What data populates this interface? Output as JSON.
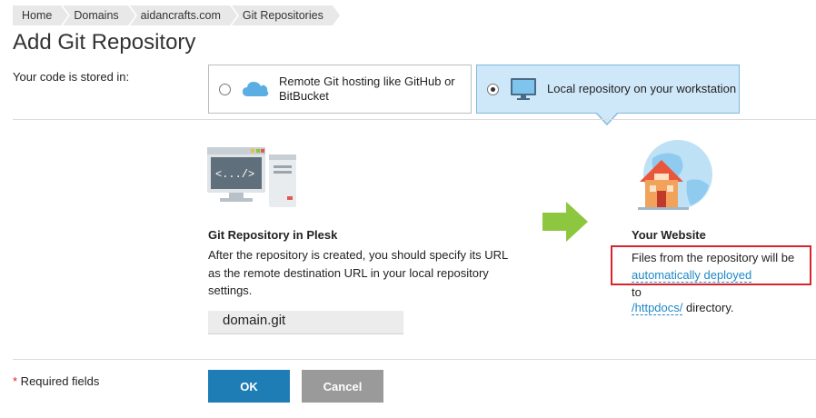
{
  "breadcrumb": [
    "Home",
    "Domains",
    "aidancrafts.com",
    "Git Repositories"
  ],
  "page_title": "Add Git Repository",
  "stored_label": "Your code is stored in:",
  "options": {
    "remote": {
      "label": "Remote Git hosting like GitHub or BitBucket",
      "selected": false,
      "icon": "cloud-icon"
    },
    "local": {
      "label": "Local repository on your workstation",
      "selected": true,
      "icon": "monitor-icon"
    }
  },
  "plesk": {
    "icon_text": "<.../>",
    "title": "Git Repository in Plesk",
    "description": "After the repository is created, you should specify its URL as the remote destination URL in your local repository settings.",
    "repo_name": "domain.git"
  },
  "website": {
    "title": "Your Website",
    "desc_prefix": "Files from the repository will be",
    "deploy_link": "automatically deployed",
    "to_text": "to",
    "dir_link": "/httpdocs/",
    "dir_suffix": " directory."
  },
  "footer": {
    "required_star": "*",
    "required_text": " Required fields",
    "ok_label": "OK",
    "cancel_label": "Cancel"
  },
  "colors": {
    "accent": "#1f7db6",
    "selected_bg": "#cfe8f9",
    "highlight": "#d9232d",
    "arrow": "#8dc63f"
  }
}
